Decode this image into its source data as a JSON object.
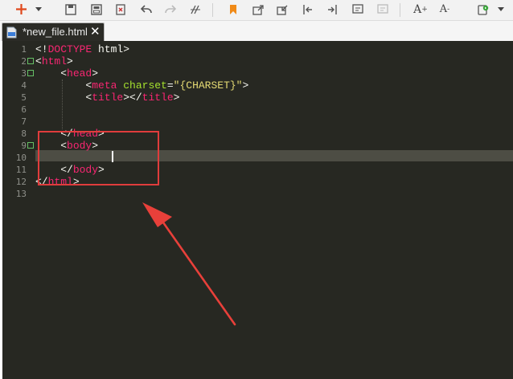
{
  "toolbar": {
    "buttons": [
      {
        "name": "new-file-icon",
        "glyph": "+"
      },
      {
        "name": "dropdown-arrow-icon",
        "glyph": "▾"
      },
      {
        "name": "save-icon",
        "glyph": ""
      },
      {
        "name": "save-all-icon",
        "glyph": ""
      },
      {
        "name": "close-file-icon",
        "glyph": ""
      },
      {
        "name": "undo-icon",
        "glyph": ""
      },
      {
        "name": "redo-icon",
        "glyph": ""
      },
      {
        "name": "format-icon",
        "glyph": ""
      },
      {
        "name": "bookmark-icon",
        "glyph": ""
      },
      {
        "name": "export-icon",
        "glyph": ""
      },
      {
        "name": "import-icon",
        "glyph": ""
      },
      {
        "name": "indent-left-icon",
        "glyph": ""
      },
      {
        "name": "indent-right-icon",
        "glyph": ""
      },
      {
        "name": "comment-icon",
        "glyph": ""
      },
      {
        "name": "uncomment-icon",
        "glyph": ""
      },
      {
        "name": "font-increase-icon",
        "glyph": ""
      },
      {
        "name": "font-decrease-icon",
        "glyph": ""
      },
      {
        "name": "run-icon",
        "glyph": ""
      },
      {
        "name": "run-dropdown-icon",
        "glyph": "▾"
      }
    ],
    "font_increase_label": "A",
    "font_increase_sup": "+",
    "font_decrease_label": "A",
    "font_decrease_sup": "-"
  },
  "tab": {
    "label": "*new_file.html",
    "close": "✕"
  },
  "editor": {
    "line_numbers": [
      "1",
      "2",
      "3",
      "4",
      "5",
      "6",
      "7",
      "8",
      "9",
      "10",
      "11",
      "12",
      "13"
    ],
    "lines": [
      [
        {
          "t": "<!",
          "c": "pt"
        },
        {
          "t": "DOCTYPE",
          "c": "dt"
        },
        {
          "t": " html>",
          "c": "pt"
        }
      ],
      [
        {
          "t": "<",
          "c": "pt"
        },
        {
          "t": "html",
          "c": "tg"
        },
        {
          "t": ">",
          "c": "pt"
        }
      ],
      [
        {
          "t": "    <",
          "c": "pt"
        },
        {
          "t": "head",
          "c": "tg"
        },
        {
          "t": ">",
          "c": "pt"
        }
      ],
      [
        {
          "t": "        <",
          "c": "pt"
        },
        {
          "t": "meta",
          "c": "tg"
        },
        {
          "t": " ",
          "c": "pt"
        },
        {
          "t": "charset",
          "c": "at"
        },
        {
          "t": "=",
          "c": "pt"
        },
        {
          "t": "\"{CHARSET}\"",
          "c": "st"
        },
        {
          "t": ">",
          "c": "pt"
        }
      ],
      [
        {
          "t": "        <",
          "c": "pt"
        },
        {
          "t": "title",
          "c": "tg"
        },
        {
          "t": "></",
          "c": "pt"
        },
        {
          "t": "title",
          "c": "tg"
        },
        {
          "t": ">",
          "c": "pt"
        }
      ],
      [],
      [],
      [
        {
          "t": "    </",
          "c": "pt"
        },
        {
          "t": "head",
          "c": "tg"
        },
        {
          "t": ">",
          "c": "pt"
        }
      ],
      [
        {
          "t": "    <",
          "c": "pt"
        },
        {
          "t": "body",
          "c": "tg"
        },
        {
          "t": ">",
          "c": "pt"
        }
      ],
      [],
      [
        {
          "t": "    </",
          "c": "pt"
        },
        {
          "t": "body",
          "c": "tg"
        },
        {
          "t": ">",
          "c": "pt"
        }
      ],
      [
        {
          "t": "</",
          "c": "pt"
        },
        {
          "t": "html",
          "c": "tg"
        },
        {
          "t": ">",
          "c": "pt"
        }
      ],
      []
    ],
    "fold_markers": [
      2,
      3,
      9
    ],
    "current_line": 10
  },
  "annotation": {
    "highlight_color": "#e03c3c",
    "arrow_color": "#e8403a"
  }
}
